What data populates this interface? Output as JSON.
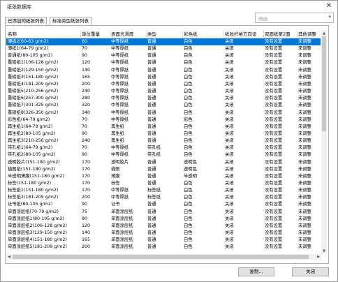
{
  "window": {
    "title": "纸张数据库",
    "close_glyph": "✕"
  },
  "tabs": [
    {
      "label": "已添加的纸张列表"
    },
    {
      "label": "标准类型纸张列表"
    }
  ],
  "filter": {
    "placeholder": "筛选",
    "arrow": "▾"
  },
  "columns": [
    "名称",
    "单位重量",
    "表面光滑度",
    "类型",
    "彩色纸",
    "纸张纤维方向设",
    "双面纸第2面",
    "其他调整"
  ],
  "rows": [
    [
      "薄纸2(60-63 g/m2)",
      "60",
      "中等厚纸",
      "普通",
      "白色",
      "关闭",
      "没有设置",
      "未调整"
    ],
    [
      "薄纸1(64-79 g/m2)",
      "70",
      "中等厚纸",
      "普通",
      "白色",
      "关闭",
      "没有设置",
      "未调整"
    ],
    [
      "普通纸(80-105 g/m2)",
      "90",
      "中等厚纸",
      "普通",
      "白色",
      "关闭",
      "没有设置",
      "未调整"
    ],
    [
      "重磅纸1(106-128 g/m2)",
      "120",
      "中等厚纸",
      "普通",
      "白色",
      "关闭",
      "没有设置",
      "未调整"
    ],
    [
      "重磅纸2(129-150 g/m2)",
      "140",
      "中等厚纸",
      "普通",
      "白色",
      "关闭",
      "没有设置",
      "未调整"
    ],
    [
      "重磅纸3(151-180 g/m2)",
      "165",
      "中等厚纸",
      "普通",
      "白色",
      "关闭",
      "没有设置",
      "未调整"
    ],
    [
      "重磅纸4(181-209 g/m2)",
      "200",
      "中等厚纸",
      "普通",
      "白色",
      "关闭",
      "没有设置",
      "未调整"
    ],
    [
      "重磅纸5(210-256 g/m2)",
      "240",
      "中等厚纸",
      "普通",
      "白色",
      "关闭",
      "没有设置",
      "未调整"
    ],
    [
      "重磅纸6(257-300 g/m2)",
      "280",
      "中等厚纸",
      "普通",
      "白色",
      "关闭",
      "没有设置",
      "未调整"
    ],
    [
      "重磅纸7(301-325 g/m2)",
      "320",
      "中等厚纸",
      "普通",
      "白色",
      "关闭",
      "没有设置",
      "未调整"
    ],
    [
      "重磅纸8(326-350 g/m2)",
      "340",
      "中等厚纸",
      "普通",
      "白色",
      "关闭",
      "没有设置",
      "未调整"
    ],
    [
      "彩色纸(64-79 g/m2)",
      "70",
      "中等厚纸",
      "普通",
      "彩色",
      "关闭",
      "没有设置",
      "未调整"
    ],
    [
      "再生纸1(64-79 g/m2)",
      "70",
      "再生纸",
      "普通",
      "白色",
      "关闭",
      "没有设置",
      "未调整"
    ],
    [
      "再生纸2(80-105 g/m2)",
      "90",
      "再生纸",
      "普通",
      "白色",
      "关闭",
      "没有设置",
      "未调整"
    ],
    [
      "再生纸3(210-256 g/m2)",
      "240",
      "再生纸",
      "普通",
      "白色",
      "关闭",
      "没有设置",
      "未调整"
    ],
    [
      "带孔纸1(64-79 g/m2)",
      "70",
      "中等厚纸",
      "带孔纸",
      "白色",
      "关闭",
      "没有设置",
      "未调整"
    ],
    [
      "带孔纸2(80-105 g/m2)",
      "90",
      "中等厚纸",
      "带孔纸",
      "白色",
      "关闭",
      "没有设置",
      "未调整"
    ],
    [
      "透明胶片(151-180 g/m2)",
      "170",
      "透明胶片",
      "普通",
      "透明色",
      "关闭",
      "没有设置",
      "未调整"
    ],
    [
      "描图纸(151-180 g/m2)",
      "170",
      "描图",
      "普通",
      "透明色",
      "关闭",
      "没有设置",
      "未调整"
    ],
    [
      "半透明薄膜(151-180 g/m2)",
      "170",
      "薄膜",
      "普通",
      "半透明",
      "关闭",
      "没有设置",
      "未调整"
    ],
    [
      "标签(151-180 g/m2)",
      "170",
      "标签",
      "普通",
      "白色",
      "关闭",
      "没有设置",
      "未调整"
    ],
    [
      "标签纸1(151-180 g/m2)",
      "170",
      "中等厚纸",
      "标签纸",
      "白色",
      "关闭",
      "没有设置",
      "未调整"
    ],
    [
      "标签纸2(181-209 g/m2)",
      "200",
      "中等厚纸",
      "标签纸",
      "白色",
      "关闭",
      "没有设置",
      "未调整"
    ],
    [
      "证书纸(80-105 g/m2)",
      "90",
      "证书",
      "普通",
      "白色",
      "关闭",
      "没有设置",
      "未调整"
    ],
    [
      "单面涂层纸(70-79 g/m2)",
      "75",
      "单面涂层纸",
      "普通",
      "白色",
      "关闭",
      "没有设置",
      "未调整"
    ],
    [
      "单面涂层纸1(80-105 g/m2)",
      "90",
      "单面涂层纸",
      "普通",
      "白色",
      "关闭",
      "没有设置",
      "未调整"
    ],
    [
      "单面涂层纸2(106-128 g/m2)",
      "120",
      "单面涂层纸",
      "普通",
      "白色",
      "关闭",
      "没有设置",
      "未调整"
    ],
    [
      "单面涂层纸3(129-150 g/m2)",
      "140",
      "单面涂层纸",
      "普通",
      "白色",
      "关闭",
      "没有设置",
      "未调整"
    ],
    [
      "单面涂层纸4(151-180 g/m2)",
      "165",
      "单面涂层纸",
      "普通",
      "白色",
      "关闭",
      "没有设置",
      "未调整"
    ],
    [
      "单面涂层纸5(181-209 g/m2)",
      "200",
      "单面涂层纸",
      "普通",
      "白色",
      "关闭",
      "没有设置",
      "未调整"
    ]
  ],
  "buttons": {
    "copy": "复制...",
    "close": "关闭"
  },
  "scroll": {
    "up": "▲",
    "down": "▼",
    "left": "◀",
    "right": "▶"
  },
  "colors": {
    "selection": "#0078d7"
  }
}
